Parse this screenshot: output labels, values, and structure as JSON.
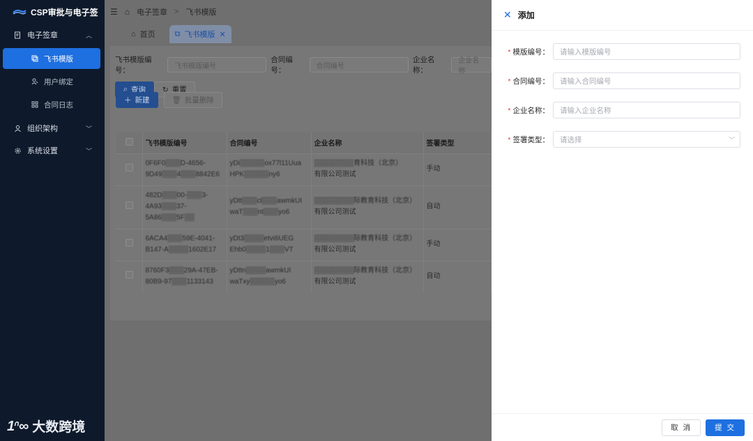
{
  "sidebar": {
    "brand": "CSP审批与电子签",
    "groups": [
      {
        "label": "电子签章",
        "icon": "document-sign-icon"
      },
      {
        "label": "组织架构",
        "icon": "user-icon"
      },
      {
        "label": "系统设置",
        "icon": "gear-icon"
      }
    ],
    "sub_items": [
      "飞书模版",
      "用户绑定",
      "合同日志"
    ],
    "footer_logo": "大数跨境",
    "footer_mark": "1ᐢ∞"
  },
  "topbar": {
    "breadcrumb": [
      "电子签章",
      "飞书模版"
    ]
  },
  "tabs": [
    {
      "label": "首页"
    },
    {
      "label": "飞书模版"
    }
  ],
  "filters": {
    "template_no_label": "飞书模版编号：",
    "template_no_placeholder": "飞书模版编号",
    "contract_no_label": "合同编号：",
    "contract_no_placeholder": "合同编号",
    "company_label": "企业名称：",
    "company_placeholder": "企业名称"
  },
  "buttons": {
    "query": "查询",
    "reset": "重置",
    "new": "新建",
    "batch_delete": "批量删除"
  },
  "table": {
    "headers": [
      "飞书模版编号",
      "合同编号",
      "企业名称",
      "签署类型"
    ],
    "rows": [
      {
        "template_no": [
          "0F6F0▒▒▒D-4656-",
          "9D49▒▒▒4▒▒▒8842E6"
        ],
        "contract_no": [
          "yDi▒▒▒▒▒ox77l11Uua",
          "HPK▒▒▒▒▒ny6"
        ],
        "company": [
          "▒▒▒▒▒▒▒▒育科技（北京）",
          "有限公司测试"
        ],
        "sign_type": "手动"
      },
      {
        "template_no": [
          "482D▒▒▒00-▒▒▒3-",
          "4A93▒▒▒37-",
          "5A86▒▒▒5F▒▒"
        ],
        "contract_no": [
          "yDtt▒▒▒cl▒▒▒awmkUI",
          "waT▒▒▒nt▒▒▒yo6"
        ],
        "company": [
          "▒▒▒▒▒▒▒▒际教育科技（北京）",
          "有限公司测试"
        ],
        "sign_type": "自动"
      },
      {
        "template_no": [
          "6ACA4▒▒▒59E-4041-",
          "B147-A▒▒▒▒1602E17"
        ],
        "contract_no": [
          "yDt3▒▒▒▒etvi6UEG",
          "Ehb0▒▒▒▒1▒▒▒VT"
        ],
        "company": [
          "▒▒▒▒▒▒▒▒际教育科技（北京）",
          "有限公司测试"
        ],
        "sign_type": "手动"
      },
      {
        "template_no": [
          "8760F3▒▒▒29A-47EB-",
          "80B9-97▒▒▒1133143"
        ],
        "contract_no": [
          "yDttn▒▒▒▒awmkUI",
          "waTxy▒▒▒▒▒yo6"
        ],
        "company": [
          "▒▒▒▒▒▒▒▒际教育科技（北京）",
          "有限公司测试"
        ],
        "sign_type": "自动"
      }
    ]
  },
  "drawer": {
    "title": "添加",
    "fields": [
      {
        "label": "模版编号：",
        "placeholder": "请输入模版编号"
      },
      {
        "label": "合同编号：",
        "placeholder": "请输入合同编号"
      },
      {
        "label": "企业名称：",
        "placeholder": "请输入企业名称"
      },
      {
        "label": "签署类型：",
        "placeholder": "请选择"
      }
    ],
    "required_mark": "*",
    "cancel": "取 消",
    "submit": "提 交"
  },
  "colors": {
    "accent": "#1e6fe0",
    "sidebar_bg": "#0e1a2b",
    "required": "#e0413f"
  }
}
